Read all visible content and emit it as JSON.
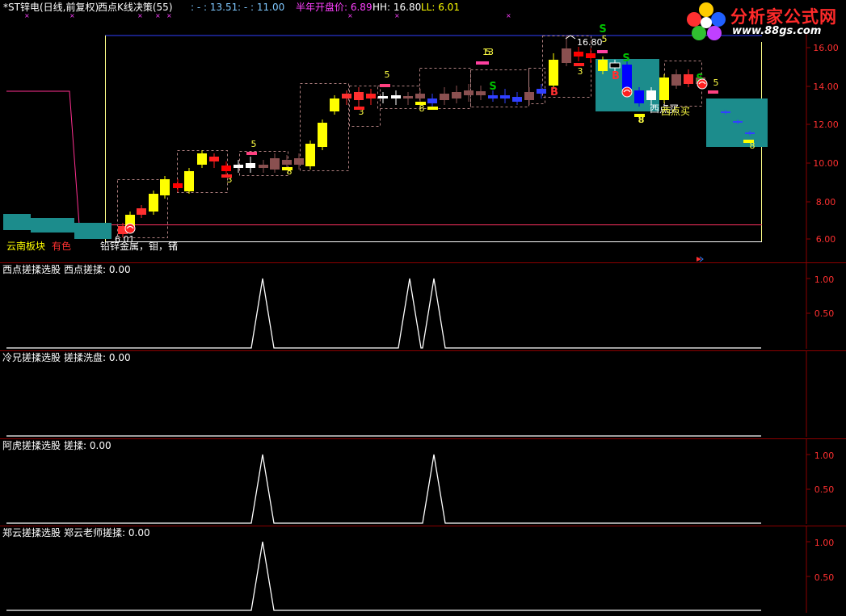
{
  "header": {
    "title": "*ST锌电(日线,前复权)",
    "indicator": "西点K线决策(55)",
    "v1_label": ": - : 13.51",
    "v2_label": ": - : 11.00",
    "half_year_open_label": "半年开盘价: 6.89",
    "hh_label": "HH: 16.80",
    "ll_label": "LL: 6.01"
  },
  "logo": {
    "name": "分析家公式网",
    "url": "www.88gs.com"
  },
  "main_chart": {
    "price_axis": [
      "16.00",
      "14.00",
      "12.00",
      "10.00",
      "8.00",
      "6.00"
    ],
    "hh_marker": "16.80",
    "ll_marker": "6.01",
    "annotations": {
      "sector": "云南板块",
      "color_tag": "有色",
      "metals": "铅锌金属，钼，锗",
      "buy_signal": "西点买",
      "buy_signal_2": "西点买"
    },
    "count_labels": [
      "5",
      "3",
      "5",
      "8",
      "5",
      "3",
      "8",
      "13",
      "8",
      "3",
      "5",
      "8",
      "8",
      "5"
    ],
    "signal_letters": [
      "S",
      "S",
      "B",
      "S",
      "S",
      "B"
    ]
  },
  "panels": [
    {
      "name": "西点搓揉选股",
      "line": "西点搓揉: 0.00",
      "ticks": [
        "1.00",
        "0.50"
      ]
    },
    {
      "name": "冷兄搓揉选股",
      "line": "搓揉洗盘: 0.00",
      "ticks": []
    },
    {
      "name": "阿虎搓揉选股",
      "line": "搓揉: 0.00",
      "ticks": [
        "1.00",
        "0.50"
      ]
    },
    {
      "name": "郑云搓揉选股",
      "line": "郑云老师搓揉: 0.00",
      "ticks": [
        "1.00",
        "0.50"
      ]
    }
  ],
  "colors": {
    "bull": "#ffff00",
    "bear_red": "#ff0000",
    "bear_blue": "#0000ff",
    "teal": "#1c8c8c",
    "separator": "#8b0000",
    "axis_text": "#ff3030",
    "signal_green": "#00c000",
    "label_yellow": "#ffff44"
  }
}
